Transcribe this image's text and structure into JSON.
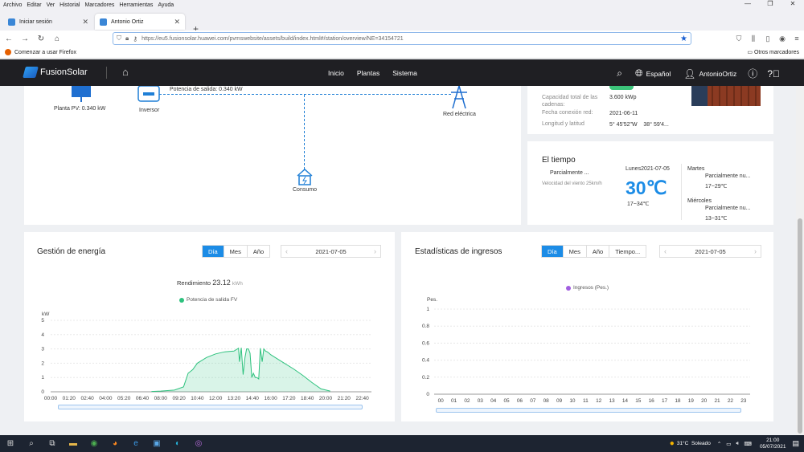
{
  "browser": {
    "menu": [
      "Archivo",
      "Editar",
      "Ver",
      "Historial",
      "Marcadores",
      "Herramientas",
      "Ayuda"
    ],
    "tabs": [
      {
        "label": "Iniciar sesión"
      },
      {
        "label": "Antonio Ortiz"
      }
    ],
    "url": "https://eu5.fusionsolar.huawei.com/pvmswebsite/assets/build/index.html#/station/overview/NE=34154721",
    "bookmark": "Comenzar a usar Firefox",
    "other_bookmarks": "Otros marcadores"
  },
  "header": {
    "brand": "FusionSolar",
    "nav": [
      "Inicio",
      "Plantas",
      "Sistema"
    ],
    "language": "Español",
    "user": "AntonioOrtiz"
  },
  "flow": {
    "output_power": "Potencia de salida: 0.340 kW",
    "plant_pv": "Planta PV: 0.340 kW",
    "inverter": "Inversor",
    "grid": "Red eléctrica",
    "consumption": "Consumo"
  },
  "plant_info": {
    "capacity_label": "Capacidad total de las cadenas:",
    "capacity_value": "3.600 kWp",
    "grid_date_label": "Fecha conexión red:",
    "grid_date_value": "2021-06-11",
    "coords_label": "Longitud y latitud",
    "coords_value": "5° 45'52\"W    38° 59'4..."
  },
  "weather": {
    "title": "El tiempo",
    "condition": "Parcialmente ...",
    "wind": "Velocidad del viento 25km/h",
    "today": "Lunes2021-07-05",
    "temp": "30℃",
    "range": "17~34℃",
    "forecast": [
      {
        "day": "Martes",
        "cond": "Parcialmente nu...",
        "range": "17~29℃"
      },
      {
        "day": "Miércoles",
        "cond": "Parcialmente nu...",
        "range": "13~31℃"
      }
    ]
  },
  "energy": {
    "title": "Gestión de energía",
    "tabs": [
      "Día",
      "Mes",
      "Año"
    ],
    "date": "2021-07-05",
    "yield_label": "Rendimiento",
    "yield_value": "23.12",
    "yield_unit": "kWh",
    "legend": "Potencia de salida FV",
    "y_unit": "kW"
  },
  "income": {
    "title": "Estadísticas de ingresos",
    "tabs": [
      "Día",
      "Mes",
      "Año",
      "Tiempo..."
    ],
    "date": "2021-07-05",
    "legend": "Ingresos (Pes.)",
    "y_unit": "Pes."
  },
  "taskbar": {
    "weather": "31°C  Soleado",
    "time": "21:00",
    "date": "05/07/2021"
  },
  "colors": {
    "accent": "#1c8ce6",
    "energy_line": "#2ec27e",
    "income_legend": "#a15ee0",
    "header_bg": "#1f1f23"
  },
  "chart_data": [
    {
      "type": "area",
      "title": "",
      "ylabel": "kW",
      "ylim": [
        0,
        5
      ],
      "yticks": [
        0,
        1,
        2,
        3,
        4,
        5
      ],
      "x_ticks": [
        "00:00",
        "01:20",
        "02:40",
        "04:00",
        "05:20",
        "06:40",
        "08:00",
        "09:20",
        "10:40",
        "12:00",
        "13:20",
        "14:40",
        "16:00",
        "17:20",
        "18:40",
        "20:00",
        "21:20",
        "22:40"
      ],
      "series": [
        {
          "name": "Potencia de salida FV",
          "x": [
            "07:20",
            "08:00",
            "09:00",
            "09:40",
            "10:00",
            "10:20",
            "10:40",
            "11:20",
            "12:00",
            "12:40",
            "13:20",
            "13:40",
            "13:44",
            "13:52",
            "14:00",
            "14:08",
            "14:15",
            "14:23",
            "14:30",
            "14:38",
            "14:45",
            "14:53",
            "15:00",
            "15:08",
            "15:15",
            "15:23",
            "15:30",
            "15:38",
            "15:45",
            "15:53",
            "16:00",
            "16:20",
            "17:00",
            "17:40",
            "18:20",
            "19:00",
            "19:40",
            "20:20"
          ],
          "y": [
            0.02,
            0.05,
            0.12,
            0.35,
            1.3,
            1.55,
            2.0,
            2.4,
            2.65,
            2.8,
            2.85,
            3.05,
            2.1,
            3.08,
            1.2,
            2.4,
            3.0,
            3.0,
            2.7,
            1.0,
            1.3,
            1.0,
            1.0,
            0.9,
            3.05,
            2.1,
            3.0,
            2.85,
            2.8,
            2.7,
            2.6,
            2.4,
            2.0,
            1.6,
            1.15,
            0.65,
            0.2,
            0.05
          ]
        }
      ]
    },
    {
      "type": "bar",
      "title": "",
      "ylabel": "Pes.",
      "ylim": [
        0,
        1
      ],
      "yticks": [
        0,
        0.2,
        0.4,
        0.6,
        0.8,
        1
      ],
      "categories": [
        "00",
        "01",
        "02",
        "03",
        "04",
        "05",
        "06",
        "07",
        "08",
        "09",
        "10",
        "11",
        "12",
        "13",
        "14",
        "15",
        "16",
        "17",
        "18",
        "19",
        "20",
        "21",
        "22",
        "23"
      ],
      "series": [
        {
          "name": "Ingresos (Pes.)",
          "values": [
            0,
            0,
            0,
            0,
            0,
            0,
            0,
            0,
            0,
            0,
            0,
            0,
            0,
            0,
            0,
            0,
            0,
            0,
            0,
            0,
            0,
            0,
            0,
            0
          ]
        }
      ]
    }
  ]
}
